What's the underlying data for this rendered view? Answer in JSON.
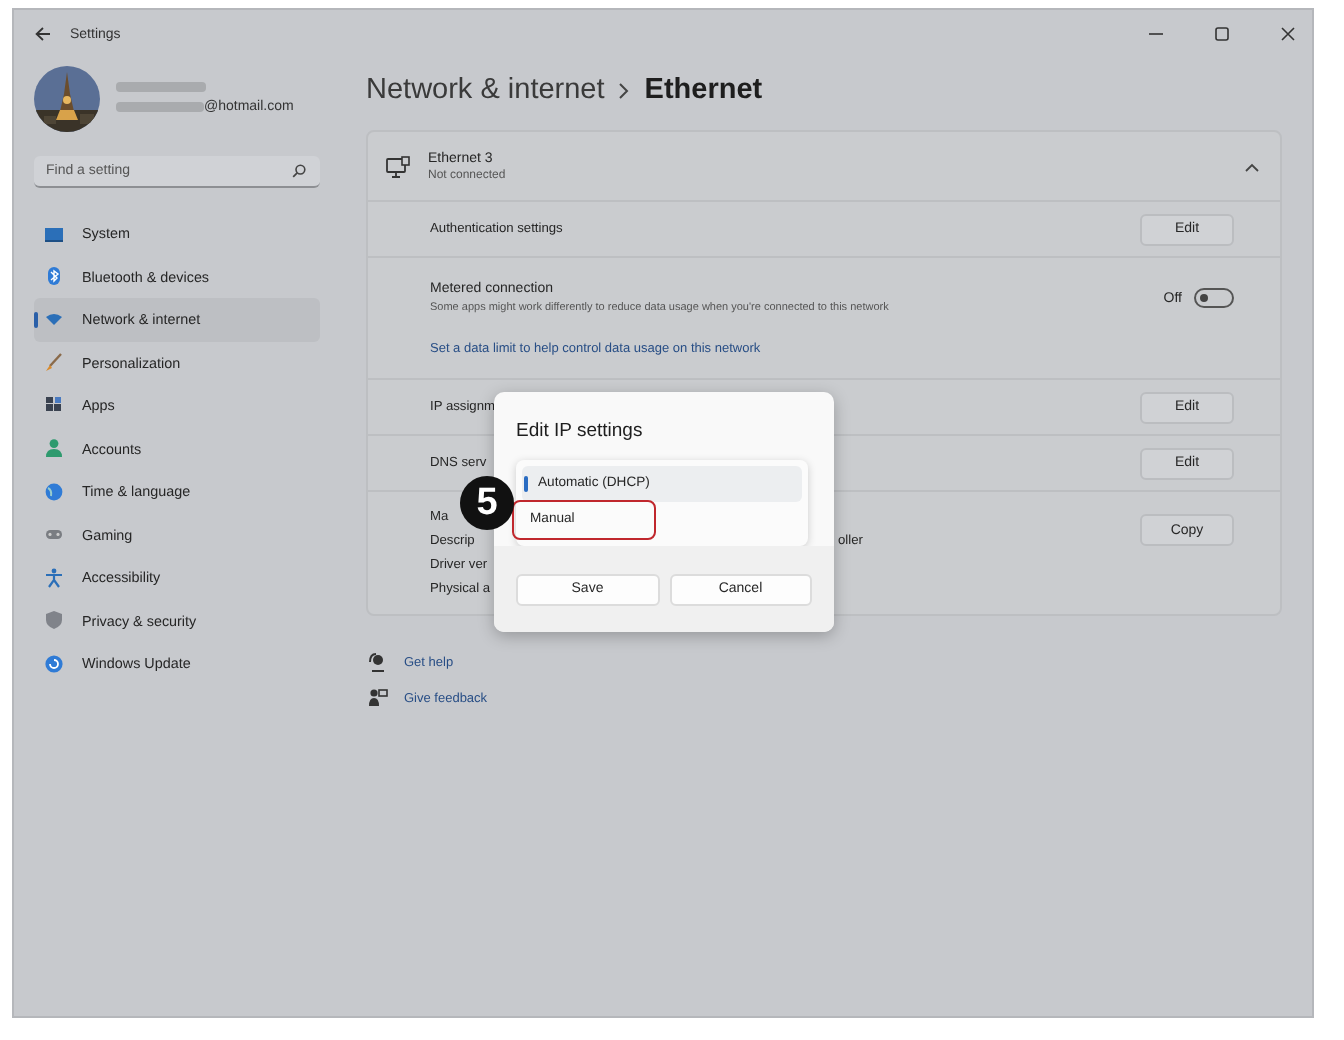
{
  "window": {
    "title": "Settings"
  },
  "profile": {
    "email": "@hotmail.com"
  },
  "search": {
    "placeholder": "Find a setting"
  },
  "nav": [
    {
      "label": "System",
      "selected": false
    },
    {
      "label": "Bluetooth & devices",
      "selected": false
    },
    {
      "label": "Network & internet",
      "selected": true
    },
    {
      "label": "Personalization",
      "selected": false
    },
    {
      "label": "Apps",
      "selected": false
    },
    {
      "label": "Accounts",
      "selected": false
    },
    {
      "label": "Time & language",
      "selected": false
    },
    {
      "label": "Gaming",
      "selected": false
    },
    {
      "label": "Accessibility",
      "selected": false
    },
    {
      "label": "Privacy & security",
      "selected": false
    },
    {
      "label": "Windows Update",
      "selected": false
    }
  ],
  "breadcrumb": {
    "parent": "Network & internet",
    "current": "Ethernet"
  },
  "adapter": {
    "name": "Ethernet 3",
    "status": "Not connected",
    "expanded": true
  },
  "settings": [
    {
      "kind": "button",
      "label": "Authentication settings",
      "button": "Edit"
    },
    {
      "kind": "toggle",
      "label": "Metered connection",
      "description": "Some apps might work differently to reduce data usage when you're connected to this network",
      "state_text": "Off",
      "on": false,
      "link": "Set a data limit to help control data usage on this network"
    },
    {
      "kind": "button",
      "label": "IP assignm",
      "button": "Edit"
    },
    {
      "kind": "button",
      "label": "DNS serv",
      "button": "Edit"
    },
    {
      "kind": "properties",
      "lines": [
        "Ma",
        "Descrip",
        "Driver ver",
        "Physical a"
      ],
      "fragment": "oller",
      "button": "Copy"
    }
  ],
  "help_links": [
    "Get help",
    "Give feedback"
  ],
  "dialog": {
    "title": "Edit IP settings",
    "options": [
      {
        "label": "Automatic (DHCP)",
        "selected": true,
        "highlighted": false
      },
      {
        "label": "Manual",
        "selected": false,
        "highlighted": true
      }
    ],
    "buttons": [
      "Save",
      "Cancel"
    ]
  },
  "annotation": {
    "step": "5"
  }
}
